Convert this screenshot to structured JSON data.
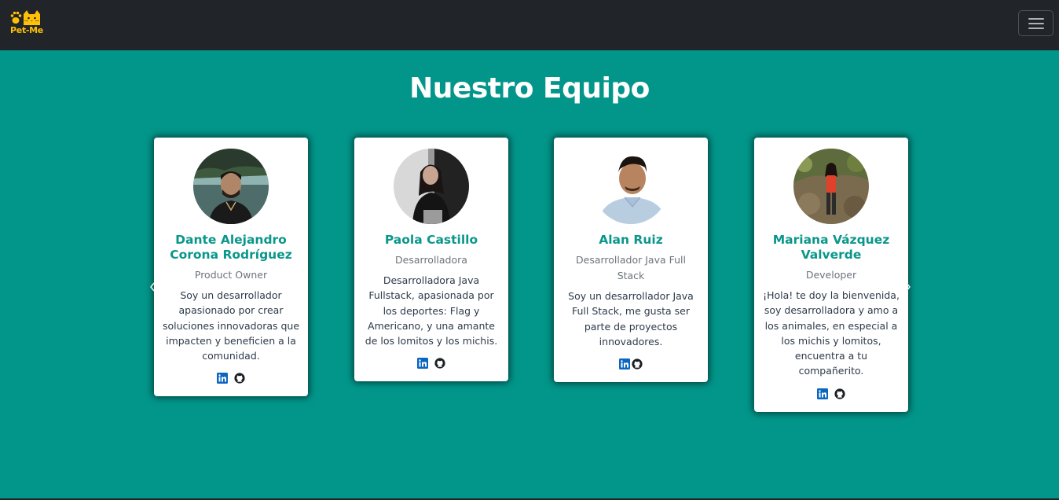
{
  "navbar": {
    "logo_text": "Pet-Me",
    "logo_icon": "paw-cat-icon",
    "menu_icon": "hamburger-menu-icon",
    "colors": {
      "background": "#212529",
      "logo": "#ffc107"
    }
  },
  "page": {
    "title": "Nuestro Equipo",
    "colors": {
      "background": "#02968a",
      "name": "#0a978a"
    }
  },
  "team": [
    {
      "name": "Dante Alejandro Corona Rodríguez",
      "role": "Product Owner",
      "bio": "Soy un desarrollador apasionado por crear soluciones innovadoras que impacten y beneficien a la comunidad.",
      "socials": [
        "linkedin-icon",
        "github-icon"
      ]
    },
    {
      "name": "Paola Castillo",
      "role": "Desarrolladora",
      "bio": "Desarrolladora Java Fullstack, apasionada por los deportes: Flag y Americano, y una amante de los lomitos y los michis.",
      "socials": [
        "linkedin-icon",
        "github-icon"
      ]
    },
    {
      "name": "Alan Ruiz",
      "role": "Desarrollador Java Full Stack",
      "bio": "Soy un desarrollador Java Full Stack, me gusta ser parte de proyectos innovadores.",
      "socials": [
        "linkedin-icon",
        "github-icon"
      ]
    },
    {
      "name": "Mariana Vázquez Valverde",
      "role": "Developer",
      "bio": "¡Hola! te doy la bienvenida, soy desarrolladora y amo a los animales, en especial a los michis y lomitos, encuentra a tu compañerito.",
      "socials": [
        "linkedin-icon",
        "github-icon"
      ]
    }
  ],
  "carousel": {
    "prev_icon": "chevron-left-icon",
    "next_icon": "chevron-right-icon"
  }
}
